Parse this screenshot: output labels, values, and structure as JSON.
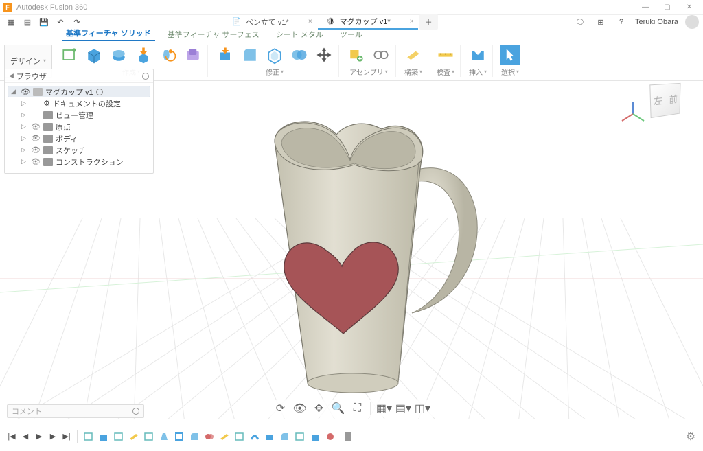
{
  "app": {
    "title": "Autodesk Fusion 360"
  },
  "window_controls": {
    "min": "—",
    "max": "▢",
    "close": "✕"
  },
  "qat": {
    "grid": "▦",
    "file": "▤",
    "save": "💾",
    "undo": "↶",
    "redo": "↷"
  },
  "doc_tabs": [
    {
      "label": "ペン立て v1*",
      "icon": "📄",
      "active": false
    },
    {
      "label": "マグカップ v1*",
      "icon": "🛡",
      "active": true
    }
  ],
  "newtab": "＋",
  "top_icons": {
    "notif": "🗨",
    "ext": "⊞",
    "help": "?"
  },
  "user": {
    "name": "Teruki Obara"
  },
  "ribbon_tabs": [
    {
      "label": "基準フィーチャ ソリッド",
      "active": true
    },
    {
      "label": "基準フィーチャ サーフェス",
      "active": false
    },
    {
      "label": "シート メタル",
      "active": false
    },
    {
      "label": "ツール",
      "active": false
    }
  ],
  "ribbon": {
    "file_label": "デザイン",
    "groups": {
      "create": "作成",
      "modify": "修正",
      "assembly": "アセンブリ",
      "construct": "構築",
      "inspect": "検査",
      "insert": "挿入",
      "select": "選択"
    }
  },
  "browser": {
    "title": "ブラウザ",
    "root": "マグカップ v1",
    "items": [
      {
        "label": "ドキュメントの設定",
        "icon": "gear"
      },
      {
        "label": "ビュー管理",
        "icon": "folder"
      },
      {
        "label": "原点",
        "icon": "folder"
      },
      {
        "label": "ボディ",
        "icon": "folder"
      },
      {
        "label": "スケッチ",
        "icon": "folder"
      },
      {
        "label": "コンストラクション",
        "icon": "folder"
      }
    ]
  },
  "viewcube": {
    "face_left": "左",
    "face_front": "前"
  },
  "comment_placeholder": "コメント",
  "timeline_controls": {
    "first": "|◀",
    "prev": "◀",
    "play": "▶",
    "next": "▶",
    "last": "▶|"
  },
  "colors": {
    "accent": "#2079c6",
    "heart": "#A65457",
    "cup": "#D8D5C7"
  }
}
